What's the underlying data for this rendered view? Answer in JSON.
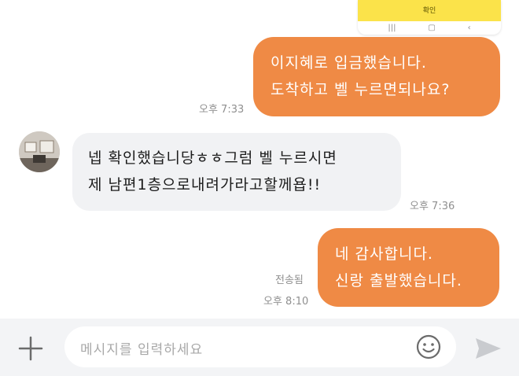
{
  "colors": {
    "outgoing_bubble": "#ef8a45",
    "incoming_bubble": "#f1f2f4",
    "input_background": "#f3f4f6",
    "pasted_banner": "#fbe34a",
    "meta_text": "#8f8f8f"
  },
  "pasted_screenshot": {
    "button_label": "확인",
    "nav_icons": [
      "recent-apps-icon",
      "home-icon",
      "back-icon"
    ]
  },
  "messages": [
    {
      "direction": "outgoing",
      "lines": [
        "이지혜로 입금했습니다.",
        "도착하고 벨 누르면되나요?"
      ],
      "time": "오후 7:33"
    },
    {
      "direction": "incoming",
      "avatar": "avatar-icon",
      "lines": [
        "넵 확인했습니당ㅎㅎ그럼 벨 누르시면",
        "제 남편1층으로내려가라고할께욥!!"
      ],
      "time": "오후 7:36"
    },
    {
      "direction": "outgoing",
      "lines": [
        "네 감사합니다.",
        "신랑 출발했습니다."
      ],
      "status": "전송됨",
      "time": "오후 8:10"
    }
  ],
  "composer": {
    "placeholder": "메시지를 입력하세요",
    "attach_icon": "plus-icon",
    "emoji_icon": "emoji-icon",
    "send_icon": "send-icon"
  }
}
